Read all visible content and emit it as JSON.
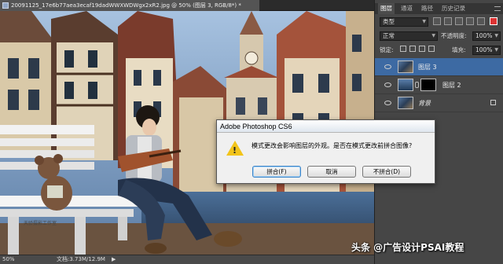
{
  "document": {
    "tab_title": "20091125_17e6b77aea3ecaf19dadWWXWDWgx2xR2.jpg @ 50% (图层 3, RGB/8*) *"
  },
  "status": {
    "zoom": "50%",
    "doc_info": "文档:3.73M/12.9M",
    "arrow": "▶"
  },
  "panels": {
    "tabs": [
      "图层",
      "通道",
      "路径",
      "历史记录"
    ],
    "filter": "类型",
    "blend_mode": "正常",
    "opacity_label": "不透明度:",
    "opacity_value": "100%",
    "lock_label": "锁定:",
    "fill_label": "填充:",
    "fill_value": "100%",
    "layers": [
      {
        "name": "图层 3",
        "active": true
      },
      {
        "name": "图层 2",
        "active": false
      },
      {
        "name": "背景",
        "active": false
      }
    ]
  },
  "dialog": {
    "title": "Adobe Photoshop CS6",
    "message": "模式更改会影响图层的外观。是否在模式更改前拼合图像?",
    "buttons": {
      "flatten": "拼合(F)",
      "cancel": "取消",
      "dont_flatten": "不拼合(D)"
    }
  },
  "canvas_text": {
    "bench_logo": "天骄摄影工作室"
  },
  "watermark": "头条 @广告设计PSAI教程"
}
